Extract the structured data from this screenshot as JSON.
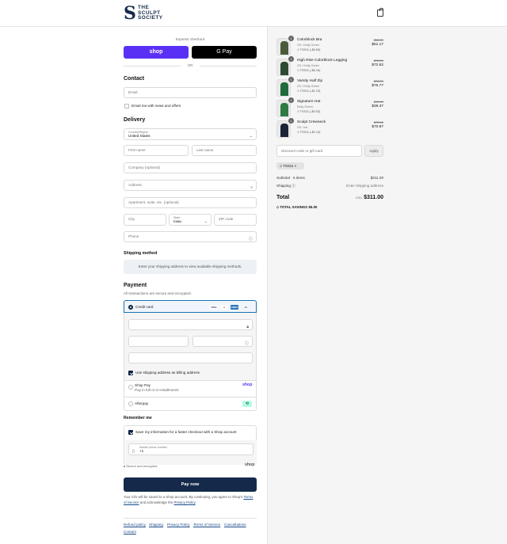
{
  "header": {
    "logo_letter": "S",
    "logo_lines": [
      "THE",
      "SCULPT",
      "SOCIETY"
    ],
    "cart_icon": "shopping-bag-icon"
  },
  "express": {
    "label": "Express checkout",
    "shop_pay": "shop",
    "google_pay": "G Pay",
    "or": "OR"
  },
  "contact": {
    "title": "Contact",
    "email_placeholder": "Email",
    "news_label": "Email me with news and offers"
  },
  "delivery": {
    "title": "Delivery",
    "country_label": "Country/Region",
    "country_value": "United States",
    "first_name": "First name",
    "last_name": "Last name",
    "company": "Company (optional)",
    "address": "Address",
    "apartment": "Apartment, suite, etc. (optional)",
    "city": "City",
    "state_label": "State",
    "state_value": "Iowa",
    "zip": "ZIP code",
    "phone": "Phone"
  },
  "shipping": {
    "title": "Shipping method",
    "message": "Enter your shipping address to view available shipping methods."
  },
  "payment": {
    "title": "Payment",
    "subtitle": "All transactions are secure and encrypted.",
    "credit_card": "Credit card",
    "cards": [
      "VISA",
      "MC",
      "AMEX",
      "+5"
    ],
    "billing_same": "Use shipping address as billing address",
    "shop_pay": "Shop Pay",
    "shop_pay_sub": "Pay in full or in installments",
    "shop_logo": "shop",
    "afterpay": "Afterpay"
  },
  "remember": {
    "title": "Remember me",
    "save_label": "Save my information for a faster checkout with a Shop account",
    "phone_label": "Mobile phone number",
    "phone_value": "+1",
    "secure": "Secure and encrypted",
    "shop_logo": "shop"
  },
  "pay_now": "Pay now",
  "legal": {
    "text1": "Your info will be saved to a Shop account. By continuing, you agree to Shop's",
    "terms": "Terms of Service",
    "and": "and acknowledge the",
    "privacy": "Privacy Policy",
    "period": "."
  },
  "footer": {
    "refund": "Refund policy",
    "shipping": "Shipping",
    "privacy": "Privacy Policy",
    "terms": "Terms of Service",
    "cancel": "Cancellations",
    "contact": "Contact"
  },
  "cart": {
    "items": [
      {
        "name": "Colorblock Bra",
        "variant": "XS / Kelly Green",
        "discount": "TSS11 (-$5.83)",
        "old": "$56.00",
        "price": "$51.17",
        "qty": "1",
        "color": "#4a5a3a"
      },
      {
        "name": "High Rise Colorblock Legging",
        "variant": "XS / Kelly Green",
        "discount": "TSS11 (-$6.16)",
        "old": "$78.00",
        "price": "$72.82",
        "qty": "1",
        "color": "#2e4a32"
      },
      {
        "name": "Varsity Half Zip",
        "variant": "XS / Kelly Green",
        "discount": "TSS11 (-$1.23)",
        "old": "$78.00",
        "price": "$76.77",
        "qty": "1",
        "color": "#1f6b3c"
      },
      {
        "name": "Signature Hat",
        "variant": "Kelly Green",
        "discount": "TSS11 (-$0.53)",
        "old": "$40.00",
        "price": "$39.37",
        "qty": "1",
        "color": "#2f7a45"
      },
      {
        "name": "Sculpt Crewneck",
        "variant": "XS / Ink",
        "discount": "TSS11 (-$0.13)",
        "old": "$73.00",
        "price": "$70.87",
        "qty": "1",
        "color": "#1a2436"
      }
    ],
    "discount_placeholder": "Discount code or gift card",
    "apply": "Apply",
    "code": "TSS11",
    "subtotal_label": "Subtotal · 5 items",
    "subtotal": "$311.00",
    "shipping_label": "Shipping",
    "shipping_value": "Enter shipping address",
    "total_label": "Total",
    "currency": "USD",
    "total": "$311.00",
    "savings_label": "TOTAL SAVINGS",
    "savings": "$5.00"
  }
}
